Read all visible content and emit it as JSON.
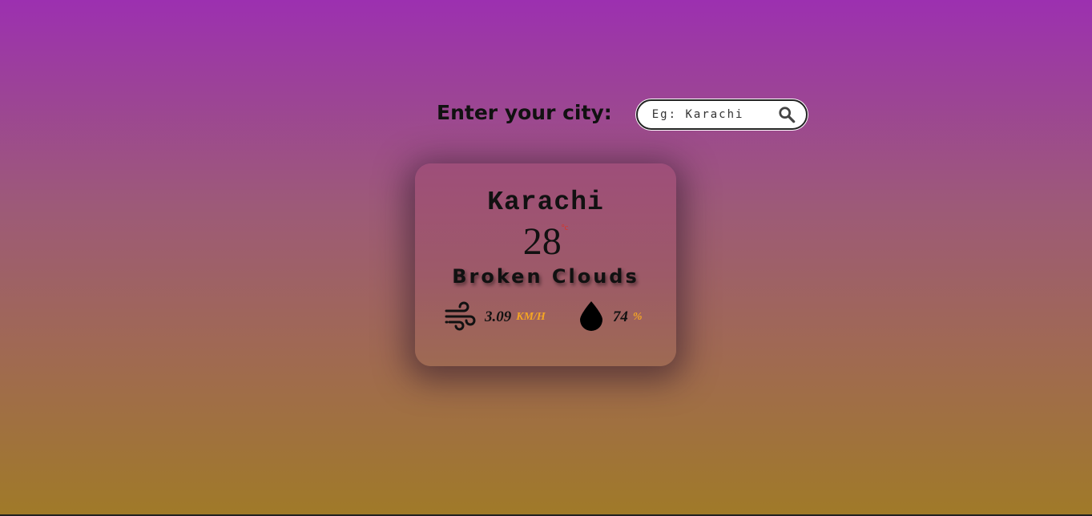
{
  "search": {
    "label": "Enter your city:",
    "placeholder": "Eg: Karachi",
    "value": "",
    "icon": "search-icon"
  },
  "weather": {
    "city": "Karachi",
    "temperature": "28",
    "temperature_unit": "°c",
    "condition": "Broken Clouds",
    "wind": {
      "icon": "wind-icon",
      "value": "3.09",
      "unit": "KM/H"
    },
    "humidity": {
      "icon": "water-drop-icon",
      "value": "74",
      "unit": "%"
    }
  },
  "colors": {
    "background_top": "#9c30b0",
    "background_bottom": "#a07a28",
    "unit_accent": "#f5a623",
    "temp_unit": "#e03020"
  }
}
